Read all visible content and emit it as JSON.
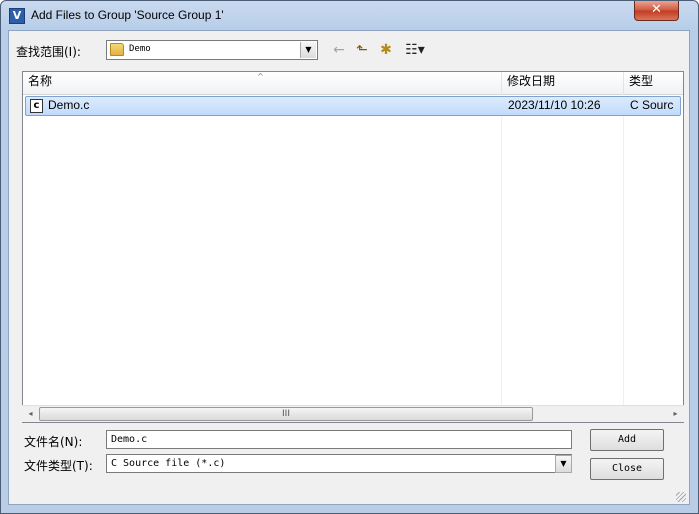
{
  "window": {
    "title": "Add Files to Group 'Source Group 1'",
    "icon_letter": "V",
    "close_glyph": "✕"
  },
  "toolbar": {
    "lookin_label": "查找范围(I):",
    "lookin_value": "Demo",
    "combo_arrow": "▼",
    "back_icon": "←",
    "up_icon": "⬑",
    "newfolder_icon": "✱",
    "view_icon": "☷▾"
  },
  "file_list": {
    "columns": [
      "名称",
      "修改日期",
      "类型"
    ],
    "sort_glyph": "^",
    "rows": [
      {
        "icon": "c",
        "name": "Demo.c",
        "modified": "2023/11/10 10:26",
        "type": "C Sourc"
      }
    ],
    "scroll_left": "◂",
    "scroll_right": "▸",
    "thumb_grip": "III"
  },
  "form": {
    "filename_label": "文件名(N):",
    "filename_value": "Demo.c",
    "filetype_label": "文件类型(T):",
    "filetype_value": "C Source file (*.c)",
    "filetype_arrow": "▼",
    "add_label": "Add",
    "close_label": "Close"
  },
  "colors": {
    "title_bar": "#c9daf0",
    "selection": "#cde3fc",
    "close_button": "#c8492f"
  }
}
